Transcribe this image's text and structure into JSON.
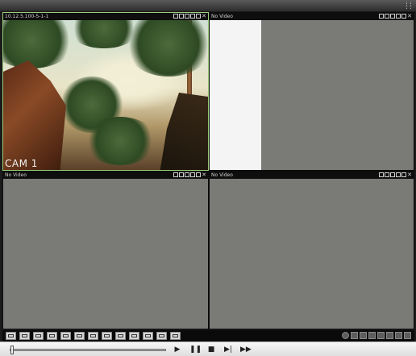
{
  "window": {
    "title": ""
  },
  "panes": [
    {
      "id": 1,
      "title": "10.12.5.100-5-1-1",
      "camera_label": "CAM 1",
      "active": true
    },
    {
      "id": 2,
      "title": "No Video",
      "active": false
    },
    {
      "id": 3,
      "title": "No Video",
      "active": false
    },
    {
      "id": 4,
      "title": "No Video",
      "active": false
    }
  ],
  "pane_icons": [
    "record-icon",
    "snapshot-icon",
    "audio-icon",
    "talk-icon",
    "fullscreen-icon",
    "close-icon"
  ],
  "layout_buttons": [
    "layout-1x1",
    "layout-2x2",
    "layout-3x3",
    "layout-1plus5",
    "layout-1plus7",
    "layout-4x4",
    "layout-5x5",
    "layout-6x6",
    "layout-1plus12",
    "layout-fit",
    "layout-fullscreen",
    "layout-snapshot",
    "layout-custom"
  ],
  "right_controls": [
    "settings-icon",
    "window-icon",
    "stop-icon",
    "ptz-icon",
    "zoom-icon",
    "record-icon",
    "capture-icon",
    "close-icon"
  ],
  "playback": {
    "controls": [
      "play",
      "pause",
      "stop",
      "step-forward",
      "fast-forward"
    ],
    "progress": 0.01
  },
  "colors": {
    "pane_background": "#7a7b76",
    "active_border": "#9ad07a",
    "pane_header": "#0e0e0e"
  }
}
